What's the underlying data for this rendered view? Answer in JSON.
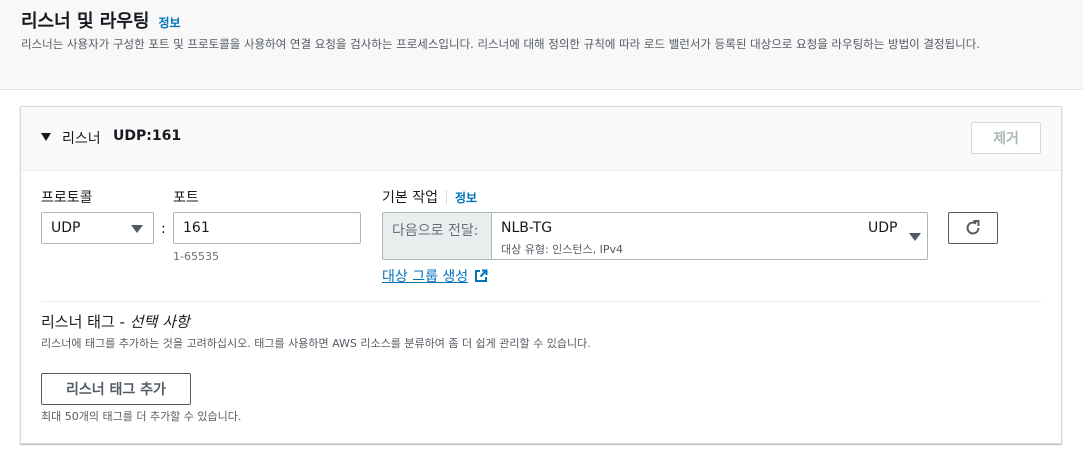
{
  "section": {
    "title": "리스너 및 라우팅",
    "info": "정보",
    "description": "리스너는 사용자가 구성한 포트 및 프로토콜을 사용하여 연결 요청을 검사하는 프로세스입니다. 리스너에 대해 정의한 규칙에 따라 로드 밸런서가 등록된 대상으로 요청을 라우팅하는 방법이 결정됩니다."
  },
  "listener": {
    "label": "리스너",
    "protocol_port": "UDP:161",
    "remove_label": "제거",
    "protocol_label": "프로토콜",
    "protocol_value": "UDP",
    "port_label": "포트",
    "port_value": "161",
    "port_hint": "1-65535",
    "default_action_label": "기본 작업",
    "default_action_info": "정보",
    "forward_to": "다음으로 전달:",
    "target_group": {
      "name": "NLB-TG",
      "subtitle": "대상 유형: 인스턴스, IPv4",
      "protocol": "UDP"
    },
    "create_target_group": "대상 그룹 생성"
  },
  "tags": {
    "title": "리스너 태그 - ",
    "optional": "선택 사항",
    "description": "리스너에 태그를 추가하는 것을 고려하십시오. 태그를 사용하면 AWS 리소스를 분류하여 좀 더 쉽게 관리할 수 있습니다.",
    "add_button": "리스너 태그 추가",
    "hint": "최대 50개의 태그를 더 추가할 수 있습니다."
  },
  "icons": {
    "collapse": "caret-down-icon",
    "dropdown": "triangle-down-icon",
    "refresh": "refresh-icon",
    "external": "external-link-icon"
  },
  "colors": {
    "link": "#0073bb",
    "text": "#16191f",
    "muted": "#545b64",
    "border": "#aab7b8"
  }
}
